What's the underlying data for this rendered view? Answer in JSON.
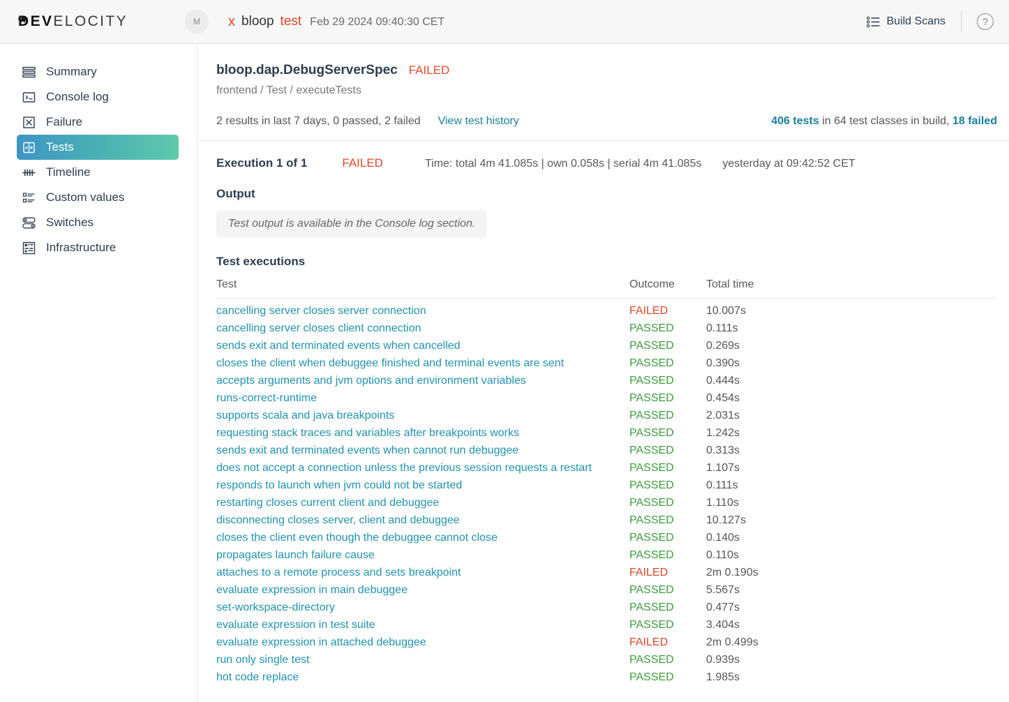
{
  "topbar": {
    "logo_dev": "DEV",
    "logo_rest": "ELOCITY",
    "avatar_initial": "M",
    "close_icon": "x",
    "project_name": "bloop",
    "task_name": "test",
    "scan_date": "Feb 29 2024 09:40:30 CET",
    "build_scans_label": "Build Scans",
    "help_label": "?"
  },
  "sidebar": {
    "items": [
      {
        "label": "Summary",
        "icon": "summary-icon",
        "active": false
      },
      {
        "label": "Console log",
        "icon": "console-icon",
        "active": false
      },
      {
        "label": "Failure",
        "icon": "failure-icon",
        "active": false
      },
      {
        "label": "Tests",
        "icon": "tests-icon",
        "active": true
      },
      {
        "label": "Timeline",
        "icon": "timeline-icon",
        "active": false
      },
      {
        "label": "Custom values",
        "icon": "custom-values-icon",
        "active": false
      },
      {
        "label": "Switches",
        "icon": "switches-icon",
        "active": false
      },
      {
        "label": "Infrastructure",
        "icon": "infrastructure-icon",
        "active": false
      }
    ]
  },
  "header": {
    "class_name": "bloop.dap.DebugServerSpec",
    "class_status": "FAILED",
    "path": "frontend / Test / executeTests",
    "results_summary": "2 results in last 7 days, 0 passed, 2 failed",
    "view_history_label": "View test history",
    "build_stats": {
      "tests_link": "406 tests",
      "middle": " in 64 test classes in build, ",
      "failed_link": "18 failed"
    }
  },
  "execution": {
    "label": "Execution 1 of 1",
    "status": "FAILED",
    "time": "Time: total 4m 41.085s | own 0.058s | serial 4m 41.085s",
    "when": "yesterday at 09:42:52 CET",
    "output_title": "Output",
    "output_text": "Test output is available in the Console log section."
  },
  "table": {
    "title": "Test executions",
    "columns": [
      "Test",
      "Outcome",
      "Total time"
    ],
    "rows": [
      {
        "test": "cancelling server closes server connection",
        "outcome": "FAILED",
        "time": "10.007s"
      },
      {
        "test": "cancelling server closes client connection",
        "outcome": "PASSED",
        "time": "0.111s"
      },
      {
        "test": "sends exit and terminated events when cancelled",
        "outcome": "PASSED",
        "time": "0.269s"
      },
      {
        "test": "closes the client when debuggee finished and terminal events are sent",
        "outcome": "PASSED",
        "time": "0.390s"
      },
      {
        "test": "accepts arguments and jvm options and environment variables",
        "outcome": "PASSED",
        "time": "0.444s"
      },
      {
        "test": "runs-correct-runtime",
        "outcome": "PASSED",
        "time": "0.454s"
      },
      {
        "test": "supports scala and java breakpoints",
        "outcome": "PASSED",
        "time": "2.031s"
      },
      {
        "test": "requesting stack traces and variables after breakpoints works",
        "outcome": "PASSED",
        "time": "1.242s"
      },
      {
        "test": "sends exit and terminated events when cannot run debuggee",
        "outcome": "PASSED",
        "time": "0.313s"
      },
      {
        "test": "does not accept a connection unless the previous session requests a restart",
        "outcome": "PASSED",
        "time": "1.107s"
      },
      {
        "test": "responds to launch when jvm could not be started",
        "outcome": "PASSED",
        "time": "0.111s"
      },
      {
        "test": "restarting closes current client and debuggee",
        "outcome": "PASSED",
        "time": "1.110s"
      },
      {
        "test": "disconnecting closes server, client and debuggee",
        "outcome": "PASSED",
        "time": "10.127s"
      },
      {
        "test": "closes the client even though the debuggee cannot close",
        "outcome": "PASSED",
        "time": "0.140s"
      },
      {
        "test": "propagates launch failure cause",
        "outcome": "PASSED",
        "time": "0.110s"
      },
      {
        "test": "attaches to a remote process and sets breakpoint",
        "outcome": "FAILED",
        "time": "2m 0.190s"
      },
      {
        "test": "evaluate expression in main debuggee",
        "outcome": "PASSED",
        "time": "5.567s"
      },
      {
        "test": "set-workspace-directory",
        "outcome": "PASSED",
        "time": "0.477s"
      },
      {
        "test": "evaluate expression in test suite",
        "outcome": "PASSED",
        "time": "3.404s"
      },
      {
        "test": "evaluate expression in attached debuggee",
        "outcome": "FAILED",
        "time": "2m 0.499s"
      },
      {
        "test": "run only single test",
        "outcome": "PASSED",
        "time": "0.939s"
      },
      {
        "test": "hot code replace",
        "outcome": "PASSED",
        "time": "1.985s"
      }
    ]
  },
  "colors": {
    "failed": "#d8472a",
    "passed": "#3d9b3d",
    "link": "#2191ad",
    "accent_teal": "#1a7f9e"
  }
}
